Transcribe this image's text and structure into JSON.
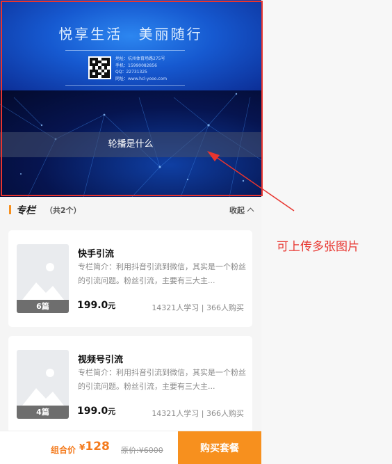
{
  "banner": {
    "slogan": "悦享生活  美丽随行",
    "contact_lines": [
      "地址：杭州体育场路275号",
      "手机：15990082856",
      "QQ：22731325",
      "网址：www.hcl-yooo.com"
    ],
    "caption": "轮播是什么"
  },
  "section": {
    "title": "专栏",
    "count": "（共2个）",
    "collapse_label": "收起"
  },
  "courses": [
    {
      "title": "快手引流",
      "description": "专栏简介：利用抖音引流到微信，其实是一个粉丝的引流问题。粉丝引流，主要有三大主...",
      "badge": "6篇",
      "price": "199.0",
      "price_unit": "元",
      "stats": "14321人学习 | 366人购买"
    },
    {
      "title": "视频号引流",
      "description": "专栏简介：利用抖音引流到微信，其实是一个粉丝的引流问题。粉丝引流，主要有三大主...",
      "badge": "4篇",
      "price": "199.0",
      "price_unit": "元",
      "stats": "14321人学习 | 366人购买"
    }
  ],
  "bottom_bar": {
    "combo_label": "组合价",
    "currency": "¥",
    "combo_price": "128",
    "original_price": "原价:¥6000",
    "buy_label": "购买套餐"
  },
  "annotation": {
    "text": "可上传多张图片"
  },
  "colors": {
    "accent": "#f7901e",
    "annotation_red": "#e8352f"
  },
  "icons": [
    "image-placeholder-icon",
    "chevron-up-icon",
    "qr-code-icon",
    "arrow-icon"
  ]
}
